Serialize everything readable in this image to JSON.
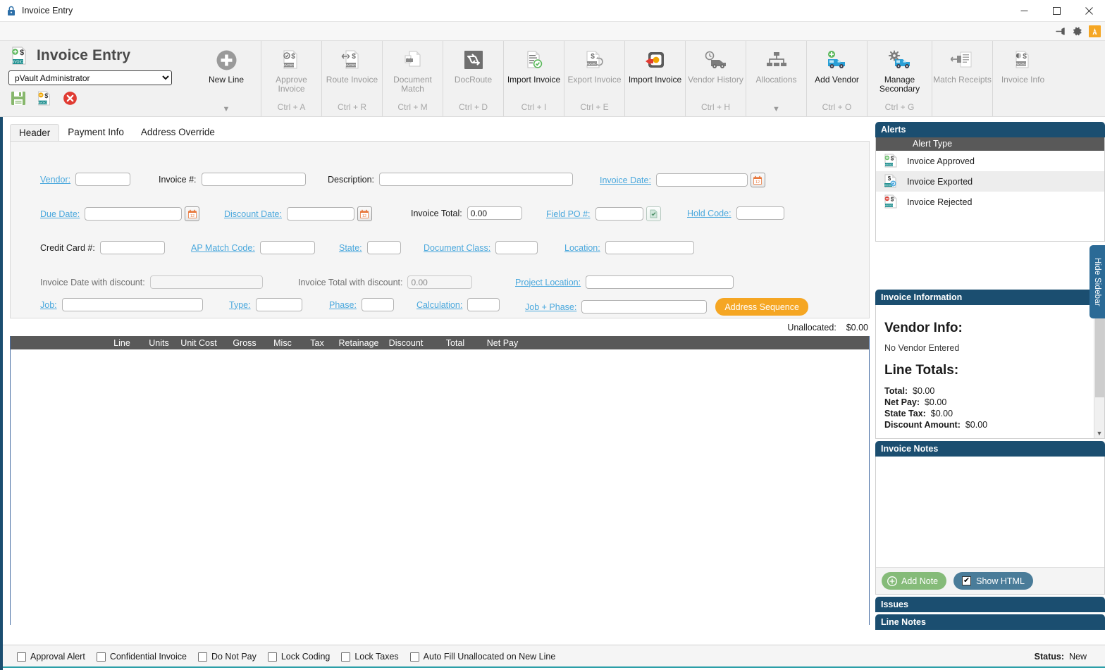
{
  "window": {
    "title": "Invoice Entry",
    "lock_icon": "lock-icon",
    "minimize": "–",
    "maximize": "□",
    "close": "✕"
  },
  "subbar": {
    "pin_icon": "pin-icon",
    "settings_icon": "gear-icon",
    "app_icon": "app-badge-icon"
  },
  "ribbon": {
    "app_title": "Invoice Entry",
    "app_icon": "invoice-add-icon",
    "user_select": "pVault Administrator",
    "user_options": [
      "pVault Administrator"
    ],
    "save_icon": "save-icon",
    "save_invoice_icon": "save-invoice-icon",
    "cancel_icon": "cancel-icon",
    "items": [
      {
        "label": "New Line",
        "key": "",
        "enabled": true,
        "dropdown": true,
        "icon": "plus-circle-icon"
      },
      {
        "label": "Approve Invoice",
        "key": "Ctrl + A",
        "enabled": false,
        "dropdown": false,
        "icon": "approve-invoice-icon"
      },
      {
        "label": "Route Invoice",
        "key": "Ctrl + R",
        "enabled": false,
        "dropdown": false,
        "icon": "route-invoice-icon"
      },
      {
        "label": "Document Match",
        "key": "Ctrl + M",
        "enabled": false,
        "dropdown": false,
        "icon": "document-match-icon"
      },
      {
        "label": "DocRoute",
        "key": "Ctrl + D",
        "enabled": false,
        "dropdown": false,
        "icon": "docroute-icon"
      },
      {
        "label": "Import Invoice",
        "key": "Ctrl + I",
        "enabled": true,
        "dropdown": false,
        "icon": "import-invoice-icon"
      },
      {
        "label": "Export Invoice",
        "key": "Ctrl + E",
        "enabled": false,
        "dropdown": false,
        "icon": "export-invoice-icon"
      },
      {
        "label": "Import Invoice",
        "key": "",
        "enabled": true,
        "dropdown": false,
        "icon": "import-invoice-alt-icon"
      },
      {
        "label": "Vendor History",
        "key": "Ctrl + H",
        "enabled": false,
        "dropdown": false,
        "icon": "vendor-history-icon"
      },
      {
        "label": "Allocations",
        "key": "",
        "enabled": false,
        "dropdown": true,
        "icon": "allocations-icon"
      },
      {
        "label": "Add Vendor",
        "key": "Ctrl + O",
        "enabled": true,
        "dropdown": false,
        "icon": "add-vendor-icon"
      },
      {
        "label": "Manage Secondary",
        "key": "Ctrl + G",
        "enabled": true,
        "dropdown": false,
        "icon": "manage-secondary-icon"
      },
      {
        "label": "Match Receipts",
        "key": "",
        "enabled": false,
        "dropdown": false,
        "icon": "match-receipts-icon"
      },
      {
        "label": "Invoice Info",
        "key": "",
        "enabled": false,
        "dropdown": false,
        "icon": "invoice-info-icon"
      }
    ]
  },
  "tabs": [
    {
      "label": "Header",
      "active": true
    },
    {
      "label": "Payment Info",
      "active": false
    },
    {
      "label": "Address Override",
      "active": false
    }
  ],
  "form": {
    "vendor": {
      "label": "Vendor:",
      "value": "",
      "link": true
    },
    "invoice_num": {
      "label": "Invoice #:",
      "value": "",
      "link": false
    },
    "description": {
      "label": "Description:",
      "value": "",
      "link": false
    },
    "invoice_date": {
      "label": "Invoice Date:",
      "value": "",
      "link": true,
      "calendar_icon": "calendar-icon"
    },
    "due_date": {
      "label": "Due Date:",
      "value": "",
      "link": true,
      "calendar_icon": "calendar-icon"
    },
    "discount_date": {
      "label": "Discount Date:",
      "value": "",
      "link": true,
      "calendar_icon": "calendar-icon"
    },
    "invoice_total": {
      "label": "Invoice Total:",
      "value": "0.00",
      "link": false
    },
    "field_po": {
      "label": "Field PO #:",
      "value": "",
      "link": true,
      "check_icon": "check-doc-icon"
    },
    "hold_code": {
      "label": "Hold Code:",
      "value": "",
      "link": true
    },
    "credit_card": {
      "label": "Credit Card #:",
      "value": "",
      "link": false
    },
    "ap_match_code": {
      "label": "AP Match Code:",
      "value": "",
      "link": true
    },
    "state": {
      "label": "State:",
      "value": "",
      "link": true
    },
    "document_class": {
      "label": "Document Class:",
      "value": "",
      "link": true
    },
    "location": {
      "label": "Location:",
      "value": "",
      "link": true
    },
    "invoice_date_discount": {
      "label": "Invoice Date with discount:",
      "value": "",
      "link": false
    },
    "invoice_total_discount": {
      "label": "Invoice Total with discount:",
      "value": "0.00",
      "link": false
    },
    "project_location": {
      "label": "Project Location:",
      "value": "",
      "link": true
    },
    "job": {
      "label": "Job:",
      "value": "",
      "link": true
    },
    "type": {
      "label": "Type:",
      "value": "",
      "link": true
    },
    "phase": {
      "label": "Phase:",
      "value": "",
      "link": true
    },
    "calculation": {
      "label": "Calculation:",
      "value": "",
      "link": true
    },
    "job_phase": {
      "label": "Job + Phase:",
      "value": "",
      "link": true
    },
    "address_sequence_button": "Address Sequence"
  },
  "unallocated": {
    "label": "Unallocated:",
    "value": "$0.00"
  },
  "grid": {
    "columns": [
      "Line",
      "Units",
      "Unit Cost",
      "Gross",
      "Misc",
      "Tax",
      "Retainage",
      "Discount",
      "Total",
      "Net Pay"
    ],
    "rows": []
  },
  "sidebar": {
    "alerts": {
      "title": "Alerts",
      "column_header": "Alert Type",
      "rows": [
        {
          "label": "Invoice Approved",
          "icon": "invoice-approved-icon",
          "selected": false
        },
        {
          "label": "Invoice Exported",
          "icon": "invoice-exported-icon",
          "selected": true
        },
        {
          "label": "Invoice Rejected",
          "icon": "invoice-rejected-icon",
          "selected": false
        }
      ]
    },
    "invoice_information": {
      "title": "Invoice Information",
      "vendor_heading": "Vendor Info:",
      "vendor_value": "No Vendor Entered",
      "totals_heading": "Line Totals:",
      "totals": [
        {
          "key": "Total:",
          "value": "$0.00"
        },
        {
          "key": "Net Pay:",
          "value": "$0.00"
        },
        {
          "key": "State Tax:",
          "value": "$0.00"
        },
        {
          "key": "Discount Amount:",
          "value": "$0.00"
        }
      ]
    },
    "invoice_notes": {
      "title": "Invoice Notes",
      "content": "",
      "add_note_button": "Add Note",
      "show_html_label": "Show HTML",
      "show_html_checked": true
    },
    "issues": {
      "title": "Issues"
    },
    "line_notes": {
      "title": "Line Notes"
    },
    "hide_sidebar": "Hide Sidebar"
  },
  "statusbar": {
    "checkboxes": [
      {
        "label": "Approval Alert",
        "checked": false
      },
      {
        "label": "Confidential Invoice",
        "checked": false
      },
      {
        "label": "Do Not Pay",
        "checked": false
      },
      {
        "label": "Lock Coding",
        "checked": false
      },
      {
        "label": "Lock Taxes",
        "checked": false
      },
      {
        "label": "Auto Fill Unallocated on New Line",
        "checked": false
      }
    ],
    "status_label": "Status:",
    "status_value": "New"
  },
  "colors": {
    "panel_header": "#1b4e70",
    "accent_orange": "#f5a623",
    "link_blue": "#4aa8dd",
    "grid_header": "#595959",
    "green_button": "#85bb79",
    "teal_button": "#4a7c99",
    "bottom_accent": "#2b9fa8"
  }
}
